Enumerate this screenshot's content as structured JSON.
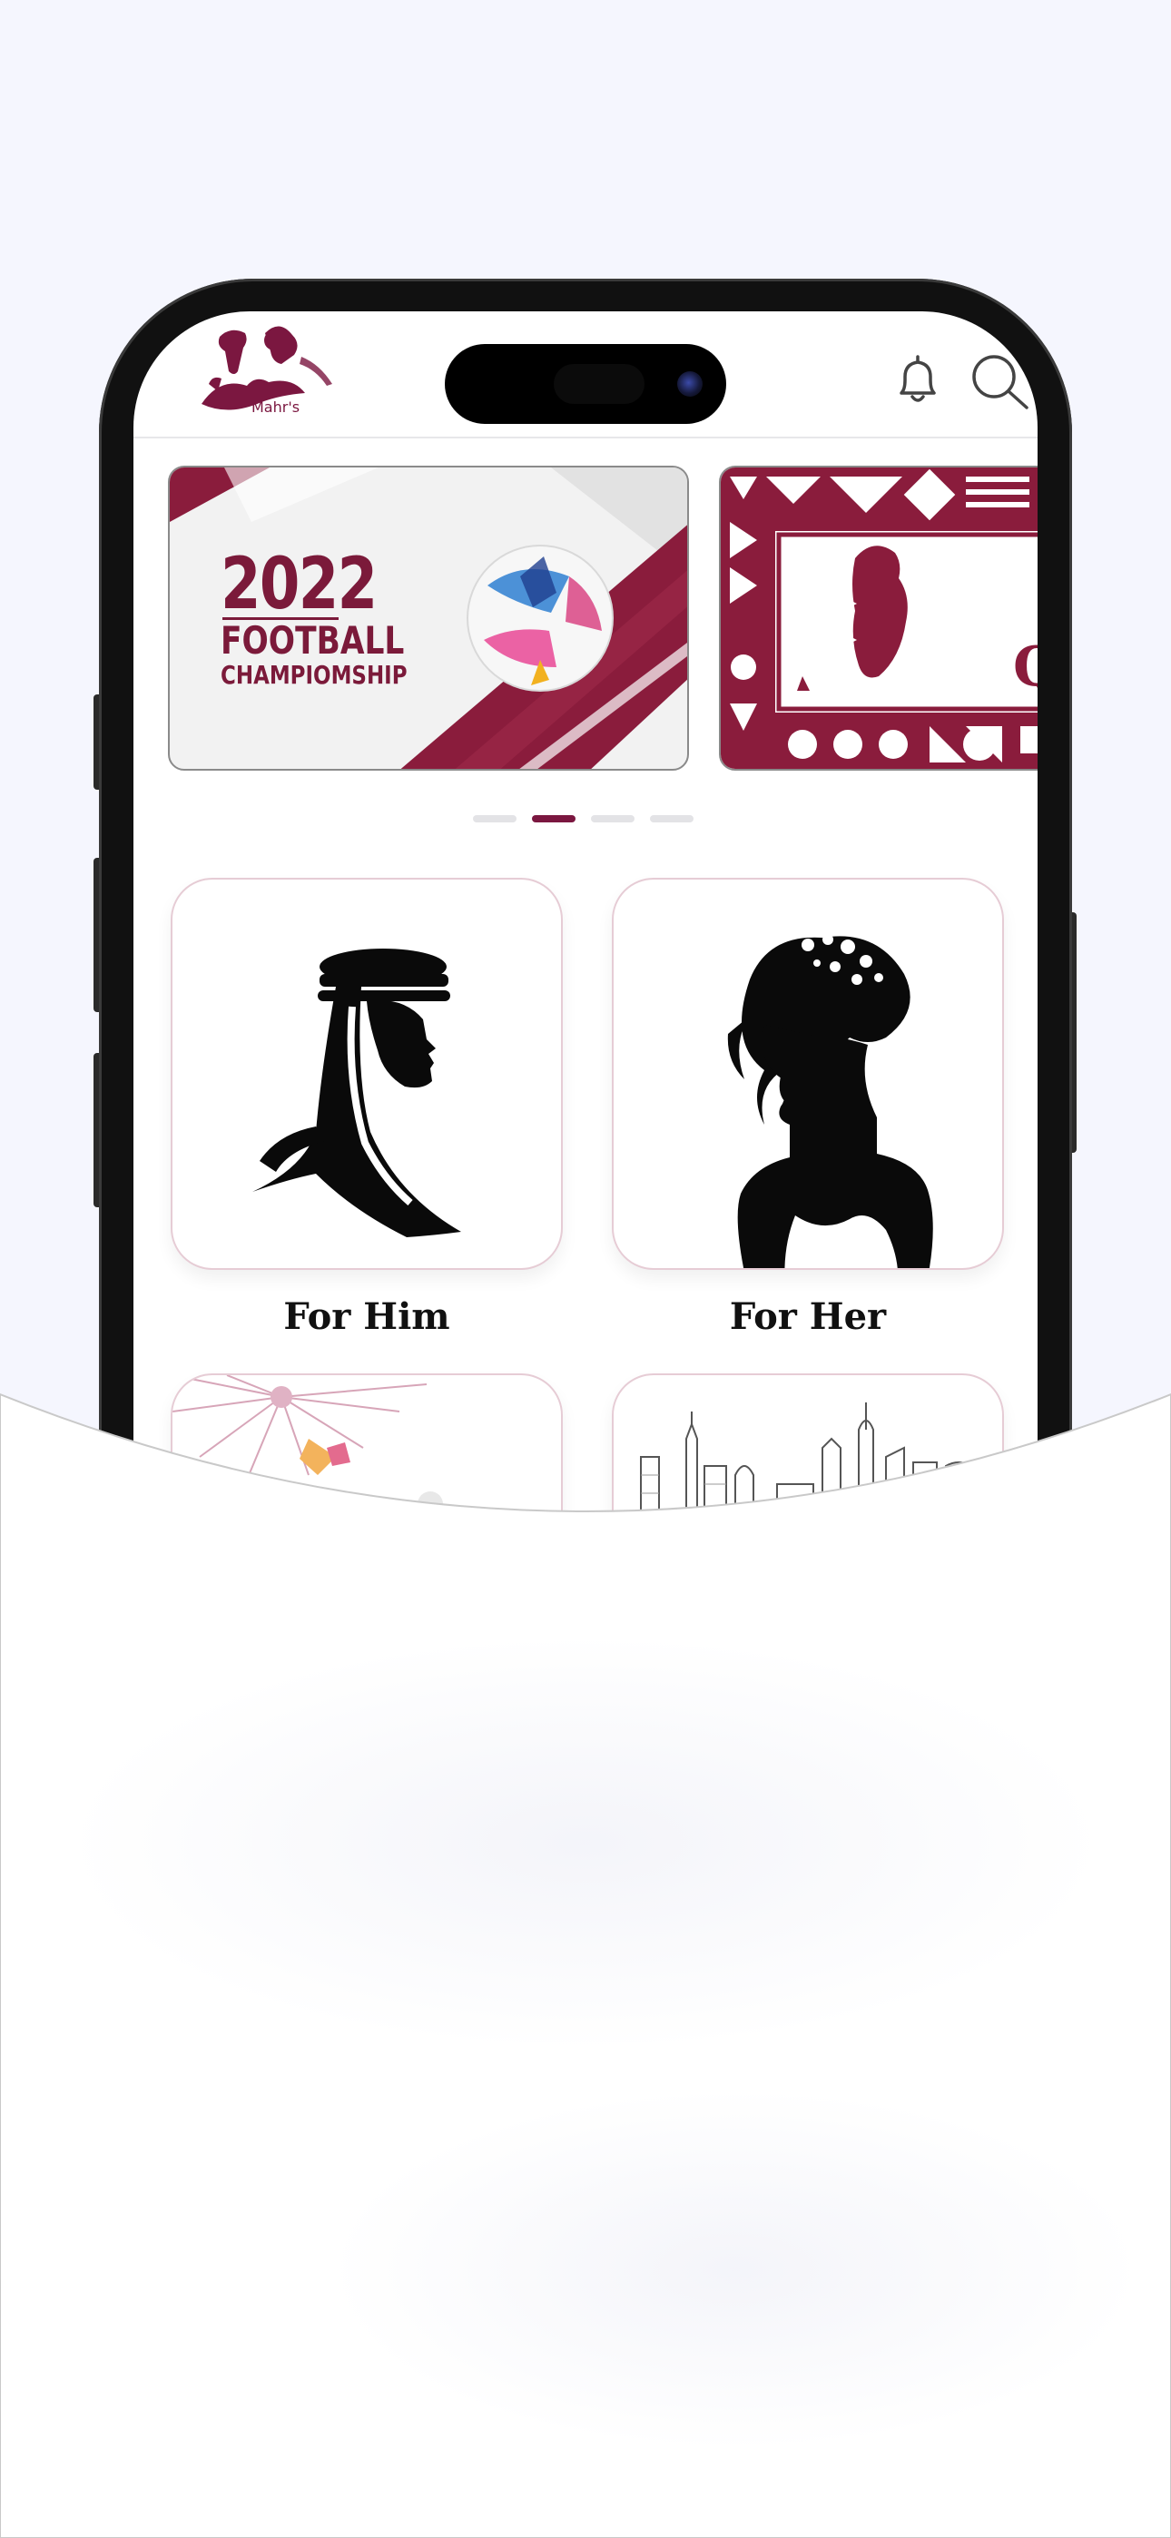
{
  "header": {
    "logo_name": "logo",
    "logo_text": "Mahr's",
    "notification_icon": "bell-icon",
    "search_icon": "search-icon"
  },
  "banners": [
    {
      "year": "2022",
      "line1": "FOOTBALL",
      "line2": "CHAMPIOMSHIP"
    },
    {
      "letter": "Q"
    }
  ],
  "carousel": {
    "page_count": 4,
    "active_index": 1
  },
  "categories": [
    {
      "label": "For Him",
      "icon": "man-silhouette-icon"
    },
    {
      "label": "For Her",
      "icon": "woman-silhouette-icon"
    },
    {
      "label": "",
      "icon": "celebration-icon"
    },
    {
      "label": "",
      "icon": "skyline-icon"
    }
  ],
  "colors": {
    "brand": "#7b1740",
    "background": "#f5f6fe",
    "card_border": "#e6ccd5"
  }
}
